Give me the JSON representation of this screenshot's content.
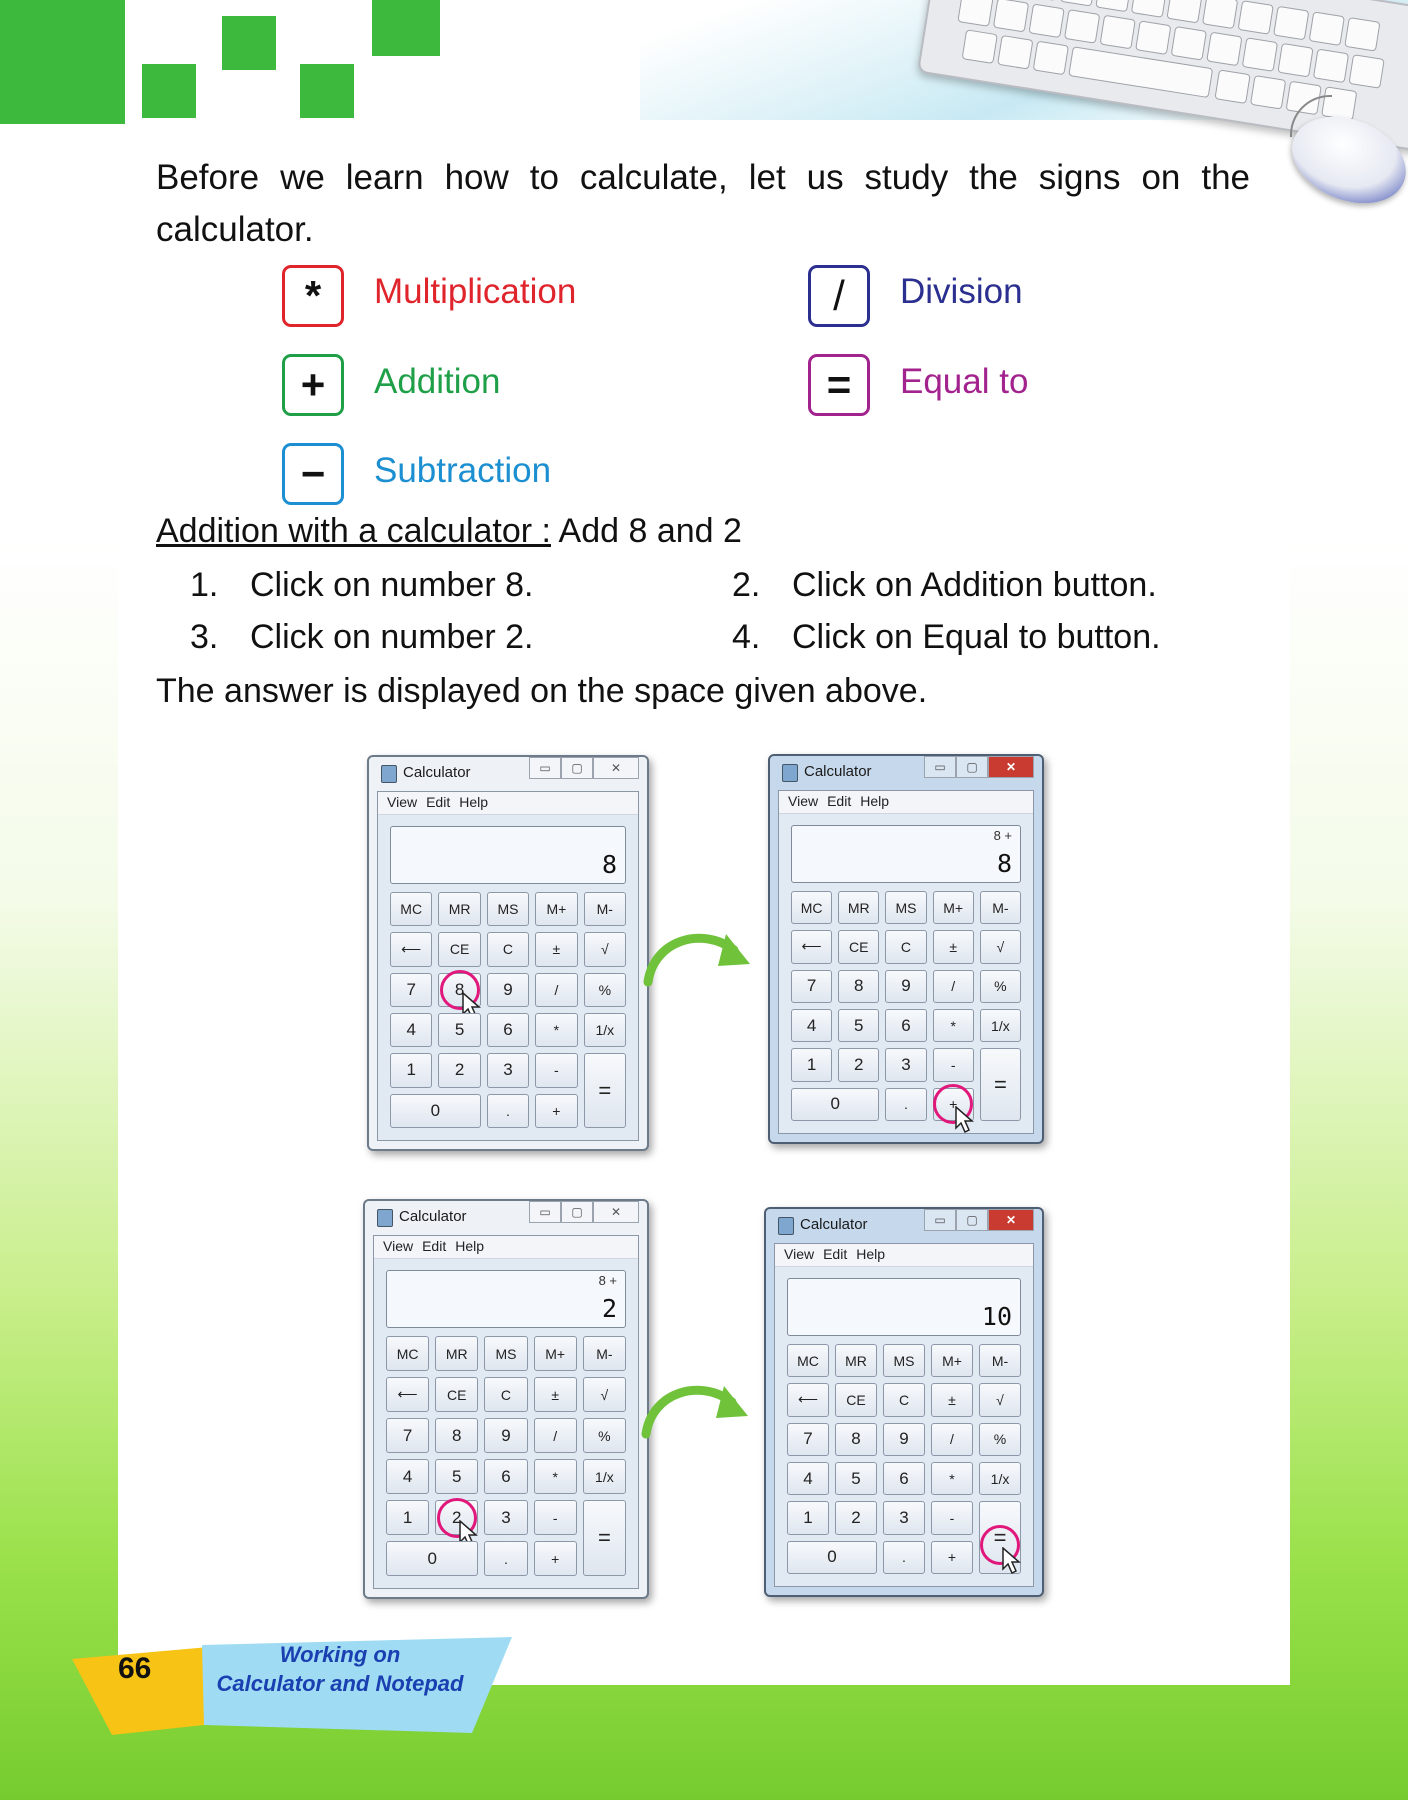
{
  "intro": "Before we learn how to calculate, let us study the signs on the calculator.",
  "signs": [
    {
      "symbol": "*",
      "label": "Multiplication",
      "color": "#e0242c"
    },
    {
      "symbol": "/",
      "label": "Division",
      "color": "#2b2f8f"
    },
    {
      "symbol": "+",
      "label": "Addition",
      "color": "#1fa048"
    },
    {
      "symbol": "=",
      "label": "Equal to",
      "color": "#a3238e"
    },
    {
      "symbol": "−",
      "label": "Subtraction",
      "color": "#1b8fd1"
    }
  ],
  "section": {
    "heading": "Addition with a calculator :",
    "task": " Add 8 and 2"
  },
  "steps": [
    {
      "num": "1.",
      "text": "Click on number 8."
    },
    {
      "num": "2.",
      "text": "Click on Addition button."
    },
    {
      "num": "3.",
      "text": "Click on number 2."
    },
    {
      "num": "4.",
      "text": "Click on Equal to button."
    }
  ],
  "result_text": "The answer is displayed on the space given above.",
  "calculator": {
    "title": "Calculator",
    "menu": [
      "View",
      "Edit",
      "Help"
    ],
    "window_buttons": {
      "min": "▭",
      "max": "▢",
      "close": "✕"
    },
    "keys": {
      "mc": "MC",
      "mr": "MR",
      "ms": "MS",
      "mplus": "M+",
      "mminus": "M-",
      "back": "⟵",
      "ce": "CE",
      "c": "C",
      "pm": "±",
      "sqrt": "√",
      "n7": "7",
      "n8": "8",
      "n9": "9",
      "div": "/",
      "pct": "%",
      "n4": "4",
      "n5": "5",
      "n6": "6",
      "mul": "*",
      "recip": "1/x",
      "n1": "1",
      "n2": "2",
      "n3": "3",
      "sub": "-",
      "eq": "=",
      "n0": "0",
      "dot": ".",
      "add": "+"
    },
    "screens": [
      {
        "history": "",
        "value": "8"
      },
      {
        "history": "8 +",
        "value": "8"
      },
      {
        "history": "8 +",
        "value": "2"
      },
      {
        "history": "",
        "value": "10"
      }
    ]
  },
  "footer": {
    "page_number": "66",
    "chapter_line1": "Working on",
    "chapter_line2": "Calculator and Notepad"
  }
}
